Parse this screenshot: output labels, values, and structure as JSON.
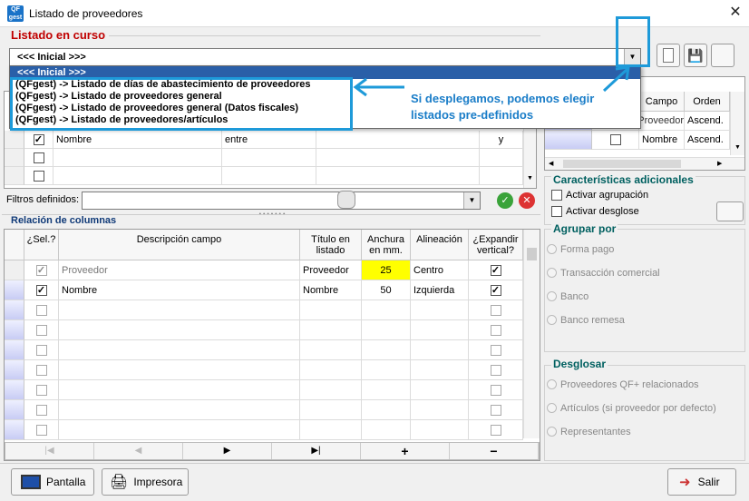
{
  "window": {
    "title": "Listado de proveedores",
    "close": "✕",
    "app_icon": "QF gest"
  },
  "listado": {
    "section_title": "Listado en curso",
    "selected": "<<< Inicial >>>",
    "options": [
      "<<< Inicial >>>",
      "(QFgest) -> Listado de días de abastecimiento de proveedores",
      "(QFgest) -> Listado de proveedores general",
      "(QFgest) -> Listado de proveedores general (Datos fiscales)",
      "(QFgest) -> Listado de proveedores/artículos"
    ]
  },
  "annotation": {
    "line1": "Si desplegamos, podemos elegir",
    "line2": "listados pre-definidos"
  },
  "filters_grid": {
    "row": {
      "campo": "Nombre",
      "op": "entre",
      "val": "y"
    }
  },
  "filtros": {
    "label": "Filtros definidos:"
  },
  "orden_grid": {
    "col_campo": "Campo",
    "col_orden": "Orden",
    "rows": [
      {
        "campo": "Proveedor",
        "orden": "Ascend."
      },
      {
        "campo": "Nombre",
        "orden": "Ascend."
      }
    ]
  },
  "columnas": {
    "section_title": "Relación de columnas",
    "headers": {
      "sel": "¿Sel.?",
      "desc": "Descripción campo",
      "titulo": "Título en listado",
      "anchura": "Anchura en mm.",
      "alin": "Alineación",
      "expandir": "¿Expandir vertical?"
    },
    "rows": [
      {
        "desc": "Proveedor",
        "titulo": "Proveedor",
        "anchura": "25",
        "alin": "Centro"
      },
      {
        "desc": "Nombre",
        "titulo": "Nombre",
        "anchura": "50",
        "alin": "Izquierda"
      }
    ],
    "nav": [
      "|◀",
      "◀",
      "▶",
      "▶|",
      "+",
      "−"
    ]
  },
  "caracteristicas": {
    "title": "Características adicionales",
    "agrupacion": "Activar agrupación",
    "desglose": "Activar desglose"
  },
  "agrupar": {
    "title": "Agrupar por",
    "options": [
      "Forma pago",
      "Transacción comercial",
      "Banco",
      "Banco remesa"
    ]
  },
  "desglosar": {
    "title": "Desglosar",
    "options": [
      "Proveedores QF+ relacionados",
      "Artículos (si proveedor por defecto)",
      "Representantes"
    ]
  },
  "footer": {
    "pantalla": "Pantalla",
    "impresora": "Impresora",
    "salir": "Salir"
  },
  "colors": {
    "accent": "#1e9ad9",
    "section_red": "#c00000",
    "highlight_yellow": "#ffff00"
  }
}
